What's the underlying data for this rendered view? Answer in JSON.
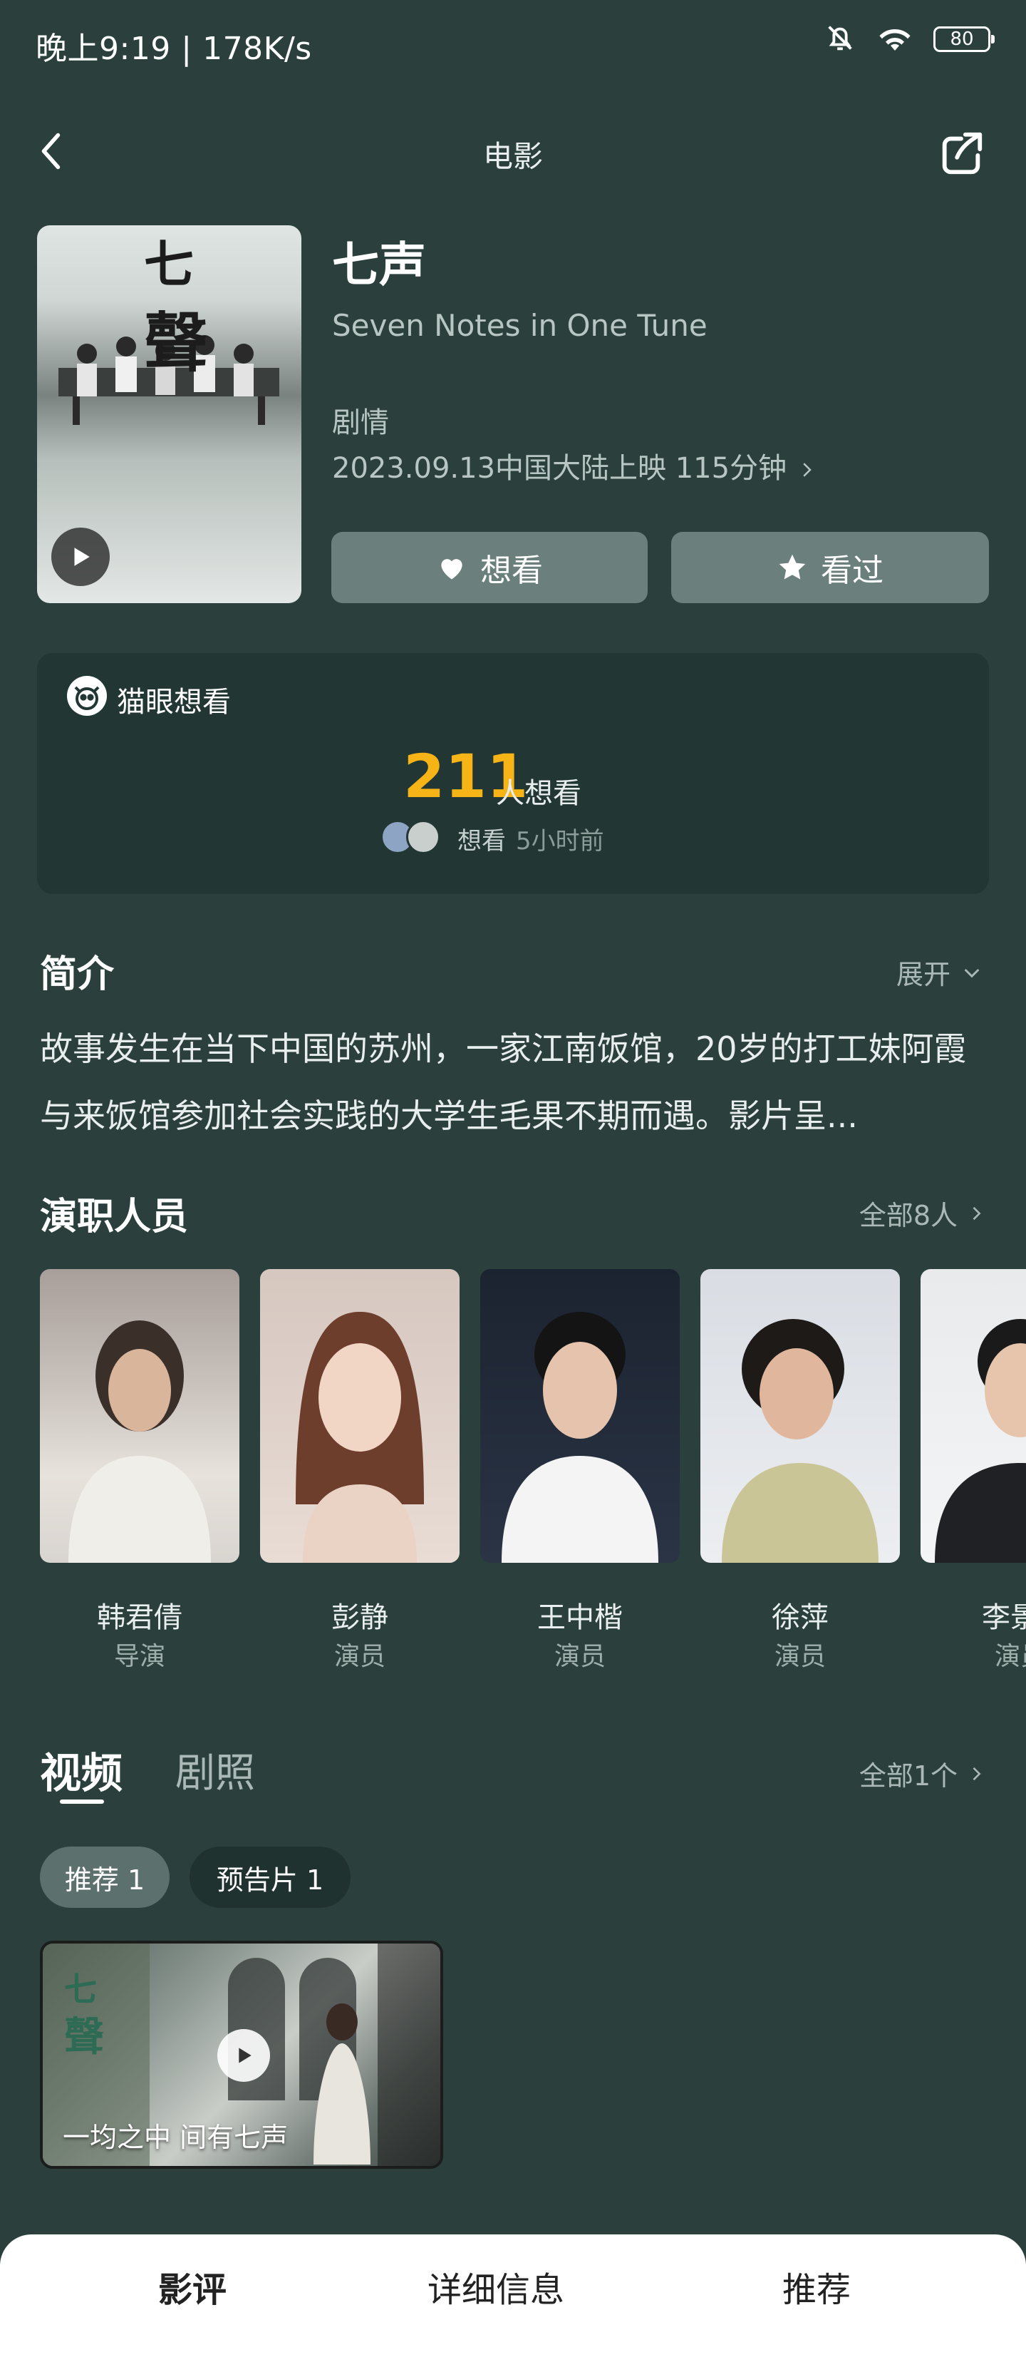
{
  "status_bar": {
    "time": "晚上9:19 | 178K/s",
    "battery": "80",
    "icons": [
      "mute-bell-icon",
      "wifi-icon",
      "battery-icon"
    ]
  },
  "nav": {
    "title": "电影",
    "back_icon": "chevron-left-icon",
    "share_icon": "share-icon"
  },
  "movie": {
    "title": "七声",
    "subtitle": "Seven Notes in One Tune",
    "genre": "剧情",
    "release": "2023.09.13中国大陆上映 115分钟",
    "want_label": "想看",
    "seen_label": "看过"
  },
  "maoyan": {
    "label": "猫眼想看",
    "count": "211",
    "count_label": "人想看",
    "activity": "想看",
    "time_ago": "5小时前"
  },
  "intro": {
    "title": "简介",
    "expand": "展开",
    "text": "故事发生在当下中国的苏州，一家江南饭馆，20岁的打工妹阿霞与来饭馆参加社会实践的大学生毛果不期而遇。影片呈..."
  },
  "cast": {
    "title": "演职人员",
    "all": "全部8人",
    "members": [
      {
        "name": "韩君倩",
        "role": "导演"
      },
      {
        "name": "彭静",
        "role": "演员"
      },
      {
        "name": "王中楷",
        "role": "演员"
      },
      {
        "name": "徐萍",
        "role": "演员"
      },
      {
        "name": "李景",
        "role": "演员"
      }
    ]
  },
  "media": {
    "tab_video": "视频",
    "tab_stills": "剧照",
    "all": "全部1个",
    "chip_recommend": "推荐 1",
    "chip_trailer": "预告片 1",
    "video_caption": "一均之中 间有七声"
  },
  "bottom_tabs": [
    "影评",
    "详细信息",
    "推荐"
  ],
  "colors": {
    "background": "#2b403d",
    "accent": "#f6b416",
    "button": "#6b7f7c",
    "card": "#223634"
  }
}
